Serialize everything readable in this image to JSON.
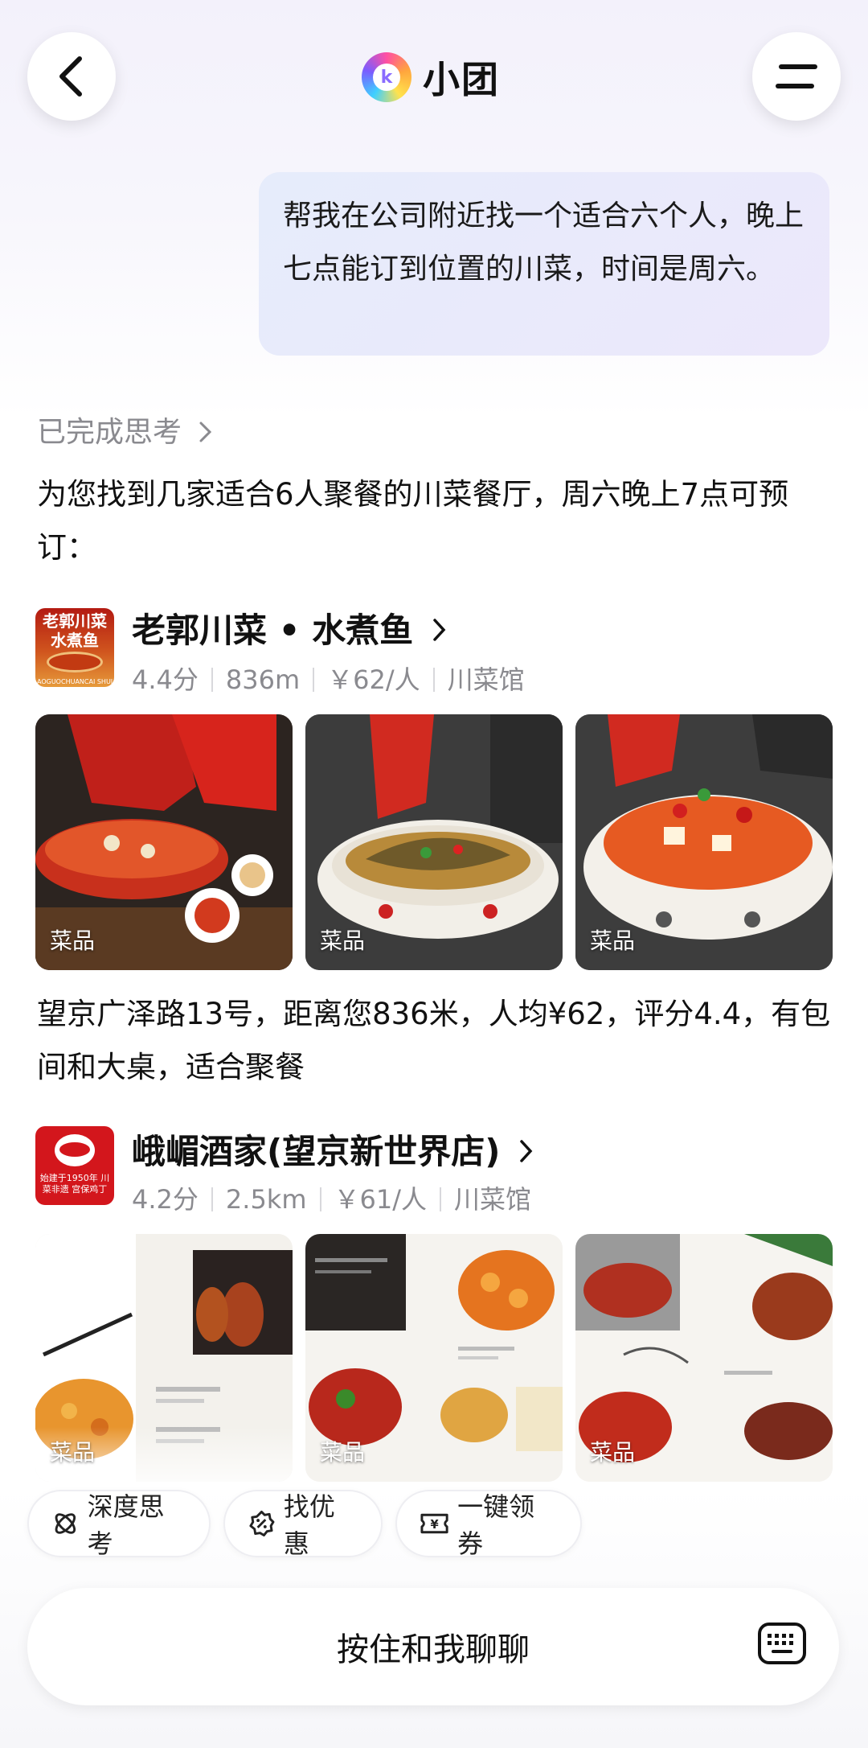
{
  "header": {
    "title": "小团",
    "logo_letter": "k"
  },
  "user_message": "帮我在公司附近找一个适合六个人，晚上七点能订到位置的川菜，时间是周六。",
  "thinking_label": "已完成思考",
  "reply_intro": "为您找到几家适合6人聚餐的川菜餐厅，周六晚上7点可预订：",
  "restaurants": [
    {
      "name": "老郭川菜 • 水煮鱼",
      "logo_text": "老郭川菜水煮鱼",
      "logo_subtext": "AOGUOCHUANCAI SHUIZHUYU",
      "rating": "4.4分",
      "distance": "836m",
      "price": "￥62/人",
      "category": "川菜馆",
      "photo_tag": "菜品",
      "description": "望京广泽路13号，距离您836米，人均¥62，评分4.4，有包间和大桌，适合聚餐"
    },
    {
      "name": "峨嵋酒家(望京新世界店)",
      "logo_text": "始建于1950年 川菜非遗 宫保鸡丁",
      "rating": "4.2分",
      "distance": "2.5km",
      "price": "￥61/人",
      "category": "川菜馆",
      "photo_tag": "菜品"
    }
  ],
  "chips": [
    "深度思考",
    "找优惠",
    "一键领券"
  ],
  "input_label": "按住和我聊聊",
  "colors": {
    "brand_pink": "#ff4fa3",
    "bubble_bg": "#e8ebfb",
    "muted_text": "#8a8a8f"
  }
}
